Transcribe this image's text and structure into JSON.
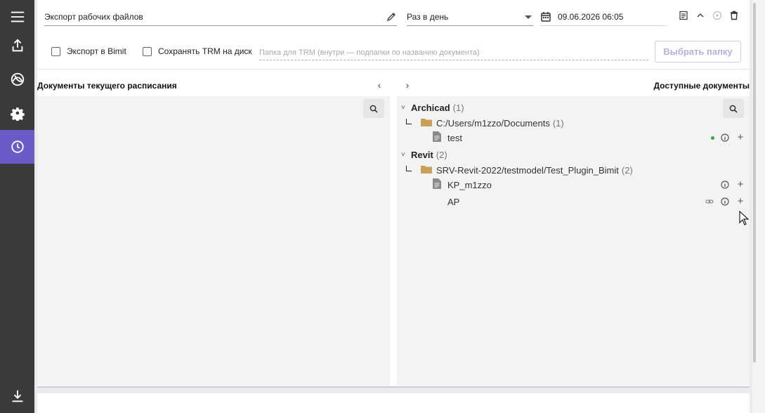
{
  "sidebar": {
    "items": [
      {
        "name": "menu",
        "icon": "hamburger-icon"
      },
      {
        "name": "export",
        "icon": "upload-icon"
      },
      {
        "name": "archicad",
        "icon": "archicad-logo-icon"
      },
      {
        "name": "settings",
        "icon": "gear-icon"
      },
      {
        "name": "schedule",
        "icon": "clock-icon",
        "active": true
      },
      {
        "name": "download",
        "icon": "download-icon"
      }
    ]
  },
  "schedule": {
    "name_value": "Экспорт рабочих файлов",
    "frequency_value": "Раз в день",
    "datetime_value": "09.06.2026 06:05",
    "export_bimit_label": "Экспорт в Bimit",
    "save_trm_label": "Сохранять TRM на диск",
    "folder_placeholder": "Папка для TRM (внутри — подпапки по названию документа)",
    "pick_folder_label": "Выбрать папку"
  },
  "left_panel": {
    "title": "Документы текущего расписания"
  },
  "right_panel": {
    "title": "Доступные документы",
    "groups": [
      {
        "name": "Archicad",
        "count": "(1)",
        "folder": "C:/Users/m1zzo/Documents",
        "folder_count": "(1)",
        "docs": [
          {
            "name": "test",
            "status": "online"
          }
        ]
      },
      {
        "name": "Revit",
        "count": "(2)",
        "folder": "SRV-Revit-2022/testmodel/Test_Plugin_Bimit",
        "folder_count": "(2)",
        "docs": [
          {
            "name": "KP_m1zzo"
          },
          {
            "name": "AP",
            "linked": true
          }
        ]
      }
    ]
  },
  "colors": {
    "sidebar_bg": "#3a3a3a",
    "accent": "#6a5cc8",
    "folder": "#c8a05a",
    "status_online": "#3aa53a"
  }
}
